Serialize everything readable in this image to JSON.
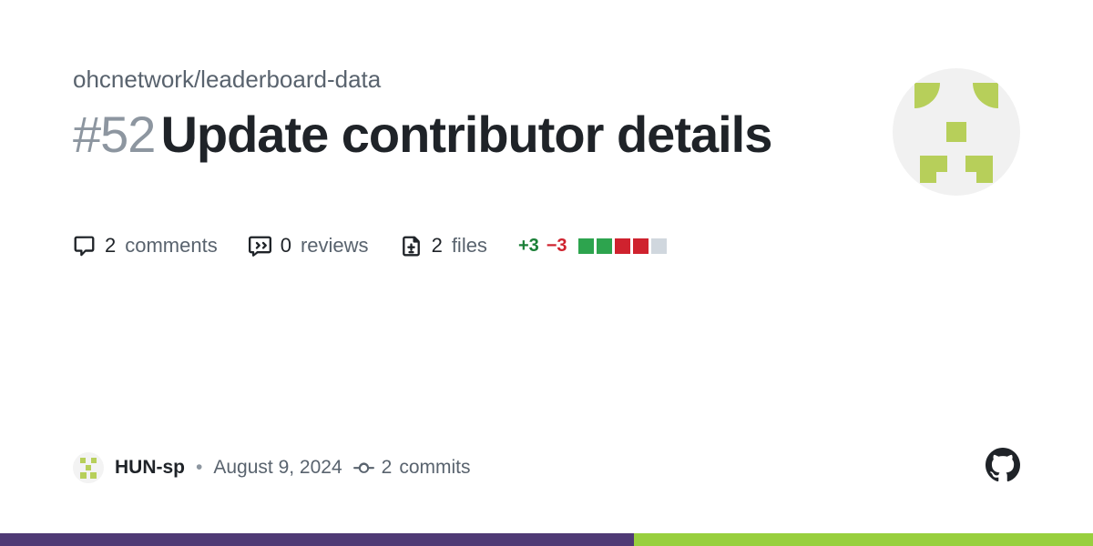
{
  "repo": "ohcnetwork/leaderboard-data",
  "pr": {
    "number_display": "#52",
    "title": "Update contributor details"
  },
  "stats": {
    "comments_count": "2",
    "comments_label": "comments",
    "reviews_count": "0",
    "reviews_label": "reviews",
    "files_count": "2",
    "files_label": "files",
    "additions": "+3",
    "deletions": "−3"
  },
  "author": {
    "name": "HUN-sp",
    "date": "August 9, 2024",
    "commits_count": "2",
    "commits_label": "commits"
  },
  "separator": "•"
}
